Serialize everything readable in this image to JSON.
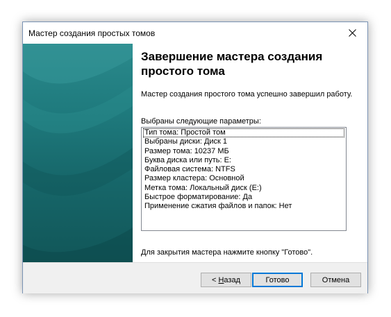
{
  "window": {
    "title": "Мастер создания простых томов"
  },
  "main": {
    "heading": "Завершение мастера создания простого тома",
    "intro": "Мастер создания простого тома успешно завершил работу.",
    "params_label": "Выбраны следующие параметры:",
    "params": [
      "Тип тома: Простой том",
      "Выбраны диски: Диск 1",
      "Размер тома: 10237 МБ",
      "Буква диска или путь: E:",
      "Файловая система: NTFS",
      "Размер кластера: Основной",
      "Метка тома: Локальный диск (E:)",
      "Быстрое форматирование: Да",
      "Применение сжатия файлов и папок: Нет"
    ],
    "closing_note": "Для закрытия мастера нажмите кнопку \"Готово\"."
  },
  "footer": {
    "back_prefix": "< ",
    "back_accel": "Н",
    "back_rest": "азад",
    "finish_label": "Готово",
    "cancel_label": "Отмена"
  },
  "colors": {
    "side_panel": "#1f7b7e",
    "default_button_border": "#0078d7"
  },
  "icons": {
    "close": "close-icon"
  }
}
